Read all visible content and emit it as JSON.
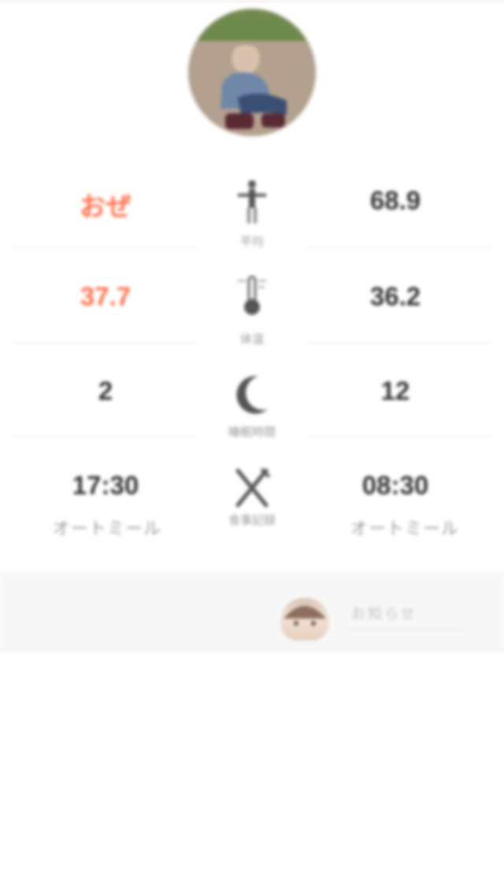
{
  "profile": {
    "avatar_desc": "profile-photo"
  },
  "stats": [
    {
      "left": "おぜ",
      "left_color": "#ff6e4a",
      "icon": "person-icon",
      "label": "平均",
      "right": "68.9",
      "right_color": "#333333"
    },
    {
      "left": "37.7",
      "left_color": "#ff6e4a",
      "icon": "thermometer-icon",
      "label": "体温",
      "right": "36.2",
      "right_color": "#333333"
    },
    {
      "left": "2",
      "left_color": "#333333",
      "icon": "moon-icon",
      "label": "睡眠時間",
      "right": "12",
      "right_color": "#333333"
    },
    {
      "left": "17:30",
      "left_sub": "オートミール",
      "left_color": "#333333",
      "icon": "fork-knife-icon",
      "label": "食事記録",
      "right": "08:30",
      "right_sub": "オートミール",
      "right_color": "#333333"
    }
  ],
  "chat": {
    "text": "お知らせ"
  }
}
